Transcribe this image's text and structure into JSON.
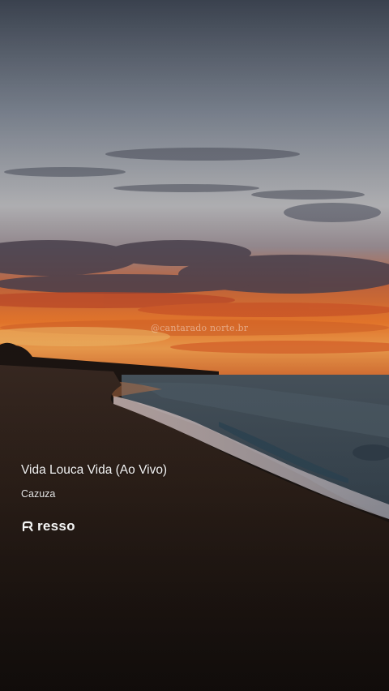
{
  "overlay": {
    "watermark": "@cantarado norte.br",
    "song_title": "Vida Louca Vida (Ao Vivo)",
    "artist": "Cazuza",
    "brand": "resso",
    "brand_icon": "resso-logo-icon"
  },
  "colors": {
    "sky_top": "#3c4453",
    "sunset_orange": "#ea6a27",
    "sand": "#2a1d17",
    "sea": "#3e4c57",
    "text": "#f2f2f2"
  }
}
